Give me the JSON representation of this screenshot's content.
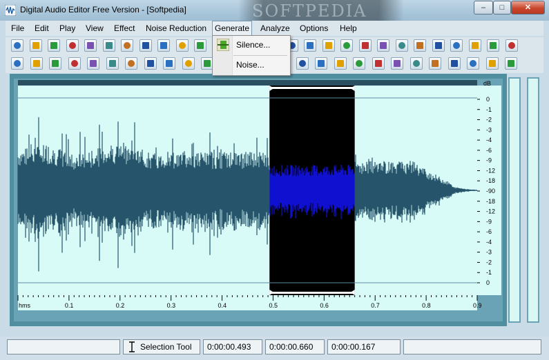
{
  "window": {
    "title": "Digital Audio Editor Free Version - [Softpedia]",
    "watermark": "SOFTPEDIA",
    "minimize": "–",
    "maximize": "□",
    "close": "✕"
  },
  "menu": {
    "items": [
      "File",
      "Edit",
      "Play",
      "View",
      "Effect",
      "Noise Reduction",
      "Generate",
      "Analyze",
      "Options",
      "Help"
    ],
    "active": "Generate"
  },
  "generate_menu": {
    "items": [
      "Silence...",
      "Noise..."
    ]
  },
  "toolbar1": {
    "icons": [
      "new-file-icon",
      "open-folder-icon",
      "save-icon",
      "save-all-icon",
      "undo-icon",
      "redo-icon",
      "find-icon",
      "copy-icon",
      "cut-icon",
      "paste-icon",
      "paste-mix-icon",
      "trim-icon",
      "wave-icon",
      "fade-in-icon",
      "fade-out-icon",
      "amplify-icon",
      "sun-icon",
      "normalize-icon",
      "loop-icon",
      "loop2-icon",
      "marker-icon",
      "box-icon",
      "equalize-icon",
      "stereo-icon",
      "spectrum-icon",
      "reverse-icon",
      "pitch-icon",
      "flanger-icon"
    ]
  },
  "toolbar2": {
    "icons": [
      "play-icon",
      "loop-play-icon",
      "record-icon",
      "pause-icon",
      "stop-icon",
      "goto-start-icon",
      "rewind-icon",
      "play-selection-icon",
      "forward-icon",
      "goto-end-icon",
      "zoom-in-icon",
      "zoom-out-icon",
      "zoom-fit-icon",
      "zoom-sel-icon",
      "tool-icon",
      "back-icon",
      "line-icon",
      "move-up-icon",
      "move-down-icon",
      "shift-icon",
      "vibrato-icon",
      "envelope-icon",
      "chorus-icon",
      "delay-icon",
      "echo-icon",
      "reverb-icon",
      "eq-icon"
    ]
  },
  "waveform": {
    "db_unit": "dB",
    "db_ticks": [
      "0",
      "-1",
      "-2",
      "-3",
      "-4",
      "-6",
      "-9",
      "-12",
      "-18",
      "-90",
      "-18",
      "-12",
      "-9",
      "-6",
      "-4",
      "-3",
      "-2",
      "-1",
      "0"
    ],
    "time_unit": "hms",
    "time_ticks": [
      "0.1",
      "0.2",
      "0.3",
      "0.4",
      "0.5",
      "0.6",
      "0.7",
      "0.8",
      "0.9"
    ],
    "colors": {
      "background": "#d9fbf8",
      "wave": "#25546b",
      "selection_bg": "#000000",
      "selection_wave": "#1010d0"
    },
    "selection_start_s": 0.493,
    "selection_end_s": 0.66,
    "duration_s": 0.9
  },
  "status": {
    "tool_label": "Selection Tool",
    "selection_start": "0:00:00.493",
    "selection_end": "0:00:00.660",
    "selection_length": "0:00:00.167"
  }
}
